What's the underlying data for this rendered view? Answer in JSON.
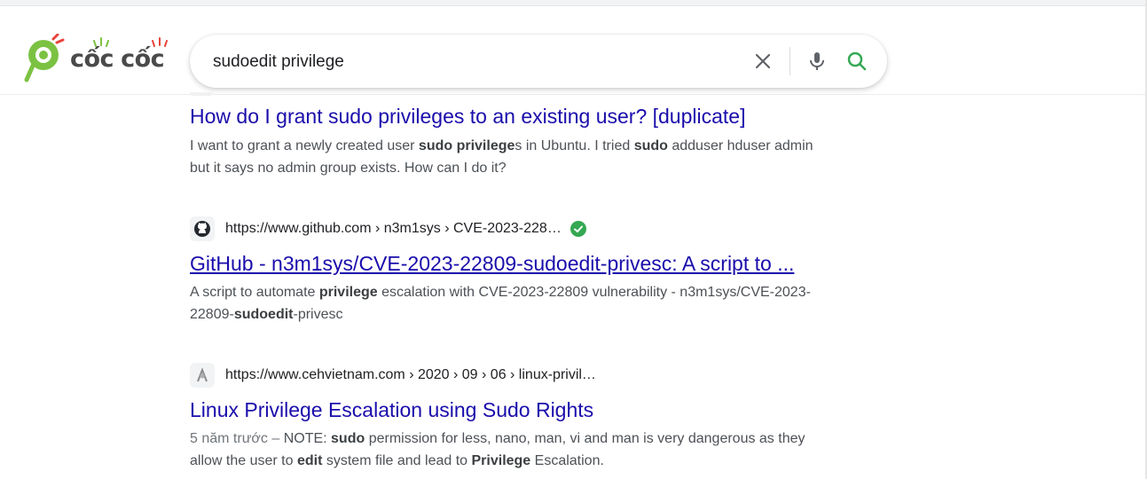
{
  "logo": {
    "word1": "cốc",
    "word2": "cốc"
  },
  "search": {
    "query": "sudoedit privilege"
  },
  "icons": {
    "clear": "close-icon",
    "voice": "microphone-icon",
    "search": "search-icon",
    "verified": "verified-check-icon"
  },
  "colors": {
    "brand_green": "#7cc242",
    "link": "#1a0dab",
    "search_green": "#34a853",
    "spark_red": "#e8453c"
  },
  "results": [
    {
      "title": "How do I grant sudo privileges to an existing user? [duplicate]",
      "snippet": {
        "line1_a": "I want to grant a newly created user ",
        "line1_b": "sudo privilege",
        "line1_c": "s in Ubuntu. I tried ",
        "line1_d": "sudo",
        "line1_e": " adduser hduser admin",
        "line2": "but it says no admin group exists. How can I do it?"
      }
    },
    {
      "url": "https://www.github.com › n3m1sys › CVE-2023-228…",
      "title": "GitHub - n3m1sys/CVE-2023-22809-sudoedit-privesc: A script to ...",
      "snippet": {
        "a": "A script to automate ",
        "b": "privilege",
        "c": " escalation with CVE-2023-22809 vulnerability - n3m1sys/CVE-2023-",
        "d": "22809-",
        "e": "sudoedit",
        "f": "-privesc"
      }
    },
    {
      "url": "https://www.cehvietnam.com › 2020 › 09 › 06 › linux-privil…",
      "title": "Linux Privilege Escalation using Sudo Rights",
      "snippet": {
        "date": "5 năm trước – ",
        "a": "NOTE: ",
        "b": "sudo",
        "c": " permission for less, nano, man, vi and man is very dangerous as they",
        "d": "allow the user to ",
        "e": "edit",
        "f": " system file and lead to ",
        "g": "Privilege",
        "h": " Escalation."
      }
    }
  ]
}
